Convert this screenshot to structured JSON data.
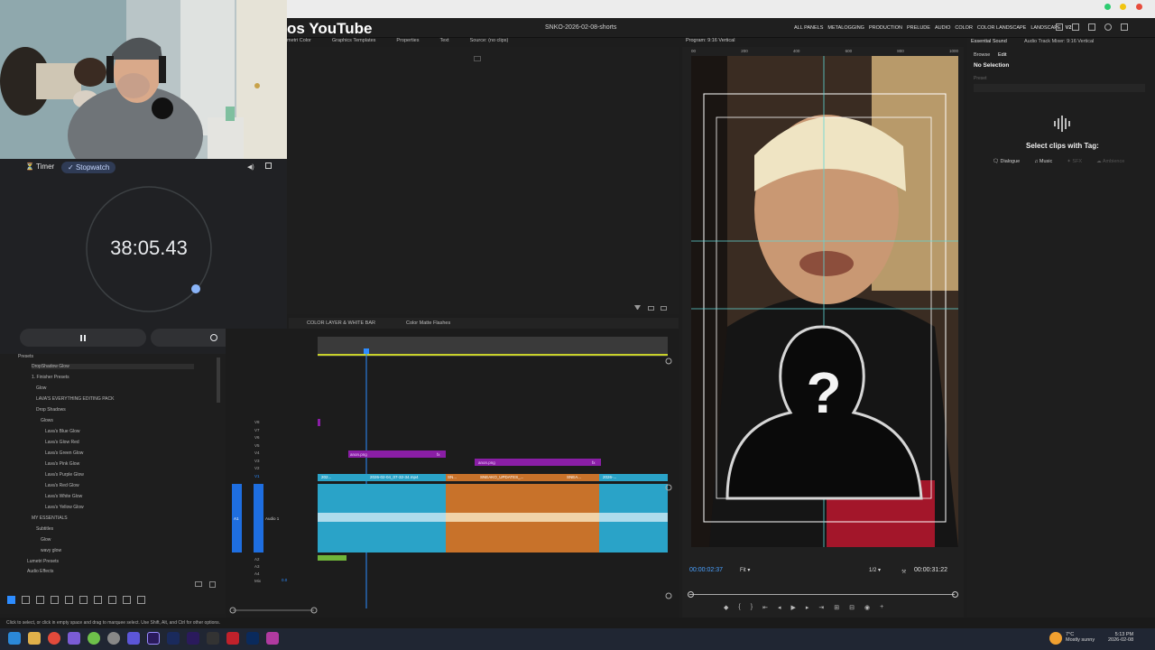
{
  "youtube_title": "os YouTube",
  "premiere": {
    "sequence_title": "SNKO-2026-02-08-shorts",
    "workspaces": [
      "ALL PANELS",
      "METALOGGING",
      "PRODUCTION",
      "PRELUDE",
      "AUDIO",
      "COLOR",
      "COLOR LANDSCAPE",
      "LANDSCAPE",
      "V2"
    ],
    "source_tabs": [
      "metri Color",
      "Graphics Templates",
      "Properties",
      "Text",
      "Source: (no clips)"
    ],
    "timeline_tabs": [
      "COLOR LAYER & WHITE BAR",
      "Color Matte Flashes"
    ],
    "program": {
      "header": "Program: 9:16 Vertical",
      "current_time": "00:00:02:37",
      "fit": "Fit",
      "ratio": "1/2",
      "duration": "00:00:31:22",
      "ruler": [
        "00",
        "200",
        "400",
        "600",
        "800",
        "1000"
      ]
    },
    "essential_sound": {
      "tab_main": "Essential Sound",
      "tab_mixer": "Audio Track Mixer: 9:16 Vertical",
      "browse": "Browse",
      "edit": "Edit",
      "no_selection": "No Selection",
      "preset_label": "Preset",
      "select_clips": "Select clips with Tag:",
      "tags": [
        "Dialogue",
        "Music",
        "SFX",
        "Ambience"
      ]
    },
    "effects_tree": [
      "Presets",
      "DropShadow Glow",
      "1. Finisher Presets",
      "Glow",
      "LAVA'S EVERYTHING EDITING PACK",
      "Drop Shadows",
      "Glows",
      "Lava's Blue Glow",
      "Lava's Glow Red",
      "Lava's Green Glow",
      "Lava's Pink Glow",
      "Lava's Purple Glow",
      "Lava's Red Glow",
      "Lava's White Glow",
      "Lava's Yellow Glow",
      "MY ESSENTIALS",
      "Subtitles",
      "Glow",
      "wavy glow",
      "Lumetri Presets",
      "Audio Effects"
    ],
    "tracks_video": [
      "V8",
      "V7",
      "V6",
      "V5",
      "V4",
      "V3",
      "V2",
      "V1"
    ],
    "tracks_audio": [
      "A1",
      "A2",
      "A3",
      "A4",
      "Mix"
    ],
    "audio_track_name": "Audio 1",
    "mix_value": "0.0",
    "clips": {
      "anon1": "anon.png",
      "anon2": "anon.png",
      "v1": [
        "202...",
        "2026-02-04_07-32-34.mp4",
        "SN...",
        "SNEAKO_UPDATES_...",
        "SNEA...",
        "2026-..."
      ],
      "fx": "fx"
    },
    "status_bar": "Click to select, or click in empty space and drag to marquee select. Use Shift, Alt, and Ctrl for other options."
  },
  "stopwatch": {
    "tab_timer": "Timer",
    "tab_stopwatch": "Stopwatch",
    "time": "38:05.43"
  },
  "taskbar": {
    "weather_temp": "7°C",
    "weather_desc": "Mostly sunny",
    "time": "5:13 PM",
    "date": "2026-02-08"
  },
  "colors": {
    "accent_blue": "#2d8cff",
    "clip_blue": "#2aa3c8",
    "clip_orange": "#c8722a",
    "clip_purple": "#8a1ea6",
    "stopwatch_accent": "#8ab4f8"
  }
}
